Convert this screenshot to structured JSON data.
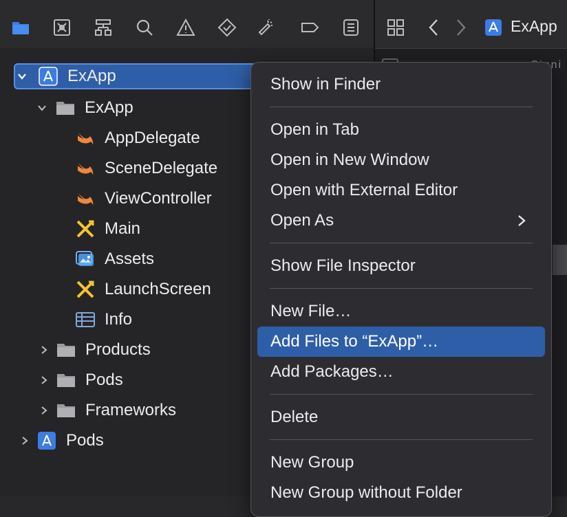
{
  "navigator_toolbar": {
    "icons": [
      "folder-icon",
      "source-control-icon",
      "hierarchy-icon",
      "search-icon",
      "warning-icon",
      "test-icon",
      "debug-icon",
      "breakpoint-icon",
      "report-icon"
    ]
  },
  "editor_toolbar": {
    "breadcrumb_title": "ExApp",
    "partial_text": "Signi"
  },
  "tree": {
    "root": {
      "label": "ExApp",
      "expanded": true
    },
    "group": {
      "label": "ExApp",
      "expanded": true
    },
    "files": [
      {
        "label": "AppDelegate",
        "icon": "swift-icon"
      },
      {
        "label": "SceneDelegate",
        "icon": "swift-icon"
      },
      {
        "label": "ViewController",
        "icon": "swift-icon"
      },
      {
        "label": "Main",
        "icon": "storyboard-icon"
      },
      {
        "label": "Assets",
        "icon": "assets-icon"
      },
      {
        "label": "LaunchScreen",
        "icon": "storyboard-icon"
      },
      {
        "label": "Info",
        "icon": "plist-icon"
      }
    ],
    "folders": [
      {
        "label": "Products"
      },
      {
        "label": "Pods"
      },
      {
        "label": "Frameworks"
      }
    ],
    "pods_project": {
      "label": "Pods"
    }
  },
  "context_menu": {
    "items": [
      "Show in Finder",
      "Open in Tab",
      "Open in New Window",
      "Open with External Editor",
      "Open As",
      "Show File Inspector",
      "New File…",
      "Add Files to “ExApp”…",
      "Add Packages…",
      "Delete",
      "New Group",
      "New Group without Folder"
    ],
    "highlighted": "Add Files to “ExApp”…"
  },
  "colors": {
    "accent": "#2f5ea8",
    "swift": "#f0873a",
    "storyboard": "#f3c431",
    "project": "#3d7ce0"
  }
}
